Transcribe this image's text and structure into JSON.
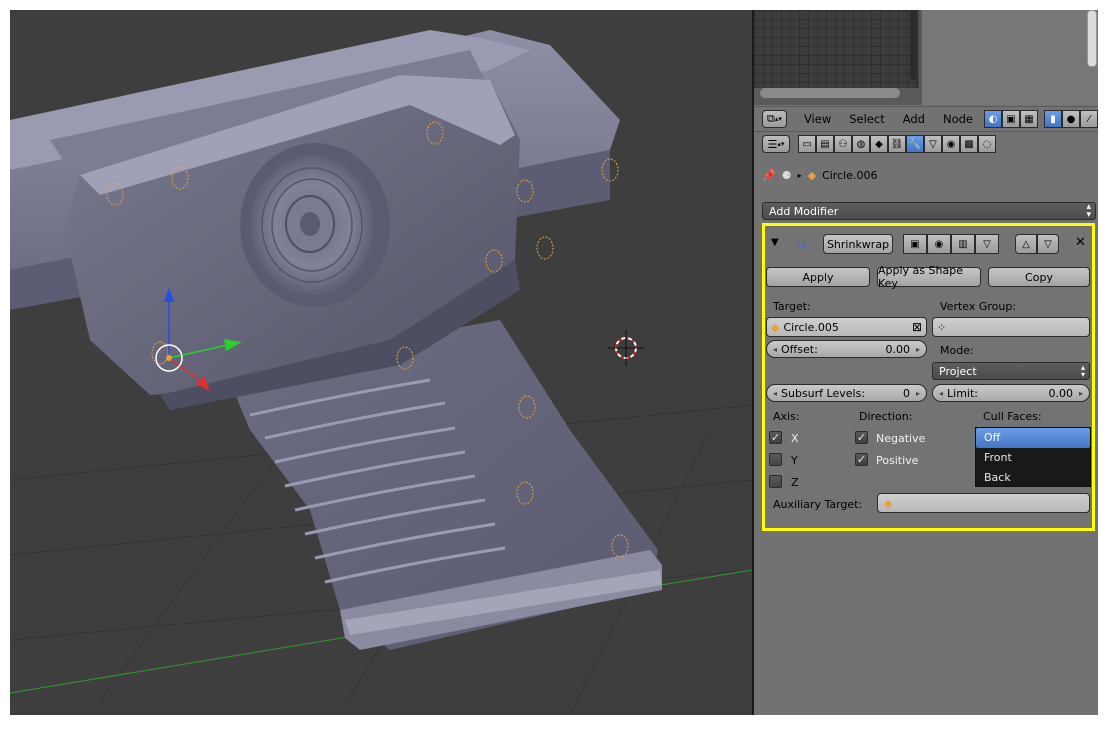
{
  "node_editor_header": {
    "menus": [
      "View",
      "Select",
      "Add",
      "Node"
    ]
  },
  "properties": {
    "breadcrumb_object": "Circle.006",
    "add_modifier_label": "Add Modifier"
  },
  "modifier": {
    "name": "Shrinkwrap",
    "apply_label": "Apply",
    "apply_shape_label": "Apply as Shape Key",
    "copy_label": "Copy",
    "target_label": "Target:",
    "target_value": "Circle.005",
    "vertex_group_label": "Vertex Group:",
    "offset_label": "Offset:",
    "offset_value": "0.00",
    "mode_label": "Mode:",
    "mode_value": "Project",
    "subsurf_label": "Subsurf Levels:",
    "subsurf_value": "0",
    "limit_label": "Limit:",
    "limit_value": "0.00",
    "axis_label": "Axis:",
    "axis_x": "X",
    "axis_y": "Y",
    "axis_z": "Z",
    "direction_label": "Direction:",
    "direction_negative": "Negative",
    "direction_positive": "Positive",
    "cull_label": "Cull Faces:",
    "cull_options": [
      "Off",
      "Front",
      "Back"
    ],
    "aux_label": "Auxiliary Target:"
  },
  "colors": {
    "highlight_border": "#ffff00",
    "selection_blue": "#5a8ad8",
    "object_orange": "#e8a23a"
  }
}
